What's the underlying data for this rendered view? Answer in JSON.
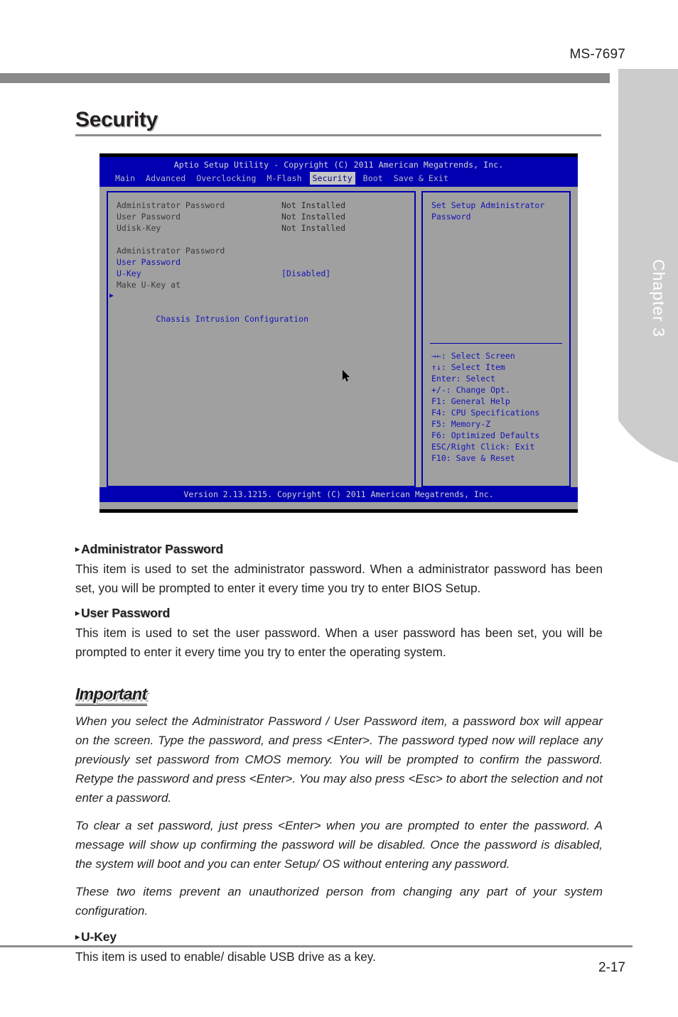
{
  "header": {
    "model_code": "MS-7697",
    "chapter_label": "Chapter 3"
  },
  "page_title": "Security",
  "bios": {
    "title": "Aptio Setup Utility - Copyright (C) 2011 American Megatrends, Inc.",
    "menu": [
      {
        "label": "Main",
        "active": false
      },
      {
        "label": "Advanced",
        "active": false
      },
      {
        "label": "Overclocking",
        "active": false
      },
      {
        "label": "M-Flash",
        "active": false
      },
      {
        "label": "Security",
        "active": true
      },
      {
        "label": "Boot",
        "active": false
      },
      {
        "label": "Save & Exit",
        "active": false
      }
    ],
    "status_rows": [
      {
        "label": "Administrator Password",
        "value": "Not Installed"
      },
      {
        "label": "User Password",
        "value": "Not Installed"
      },
      {
        "label": "Udisk-Key",
        "value": "Not Installed"
      }
    ],
    "setting_rows": [
      {
        "label": "Administrator Password",
        "value": "",
        "arrow": false
      },
      {
        "label": "User Password",
        "value": "",
        "arrow": false
      },
      {
        "label": "U-Key",
        "value": "[Disabled]",
        "arrow": false
      },
      {
        "label": "Make U-Key at",
        "value": "",
        "arrow": false
      },
      {
        "label": "Chassis Intrusion Configuration",
        "value": "",
        "arrow": true
      }
    ],
    "help_text": "Set Setup Administrator\nPassword",
    "help_keys": [
      "→←: Select Screen",
      "↑↓: Select Item",
      "Enter: Select",
      "+/-: Change Opt.",
      "F1: General Help",
      "F4: CPU Specifications",
      "F5: Memory-Z",
      "F6: Optimized Defaults",
      "ESC/Right Click: Exit",
      "F10: Save & Reset"
    ],
    "footer": "Version 2.13.1215. Copyright (C) 2011 American Megatrends, Inc."
  },
  "sections": {
    "admin_heading": "Administrator Password",
    "admin_body": "This item is used to set the administrator password. When a administrator password has been set, you will be prompted to enter it every time you try to enter BIOS Setup.",
    "user_heading": "User Password",
    "user_body": "This item is used to set the user password. When a user password has been set, you will be prompted to enter it every time you try to enter the operating system.",
    "important_title": "Important",
    "important_p1": "When you select the Administrator Password / User Password item, a password box will appear on the screen. Type the password, and press <Enter>. The password typed now will replace any previously set password from CMOS memory. You will be prompted to confirm the password. Retype the password and press <Enter>. You may also press <Esc> to abort the selection and not enter a password.",
    "important_p2": "To clear a set password, just press <Enter> when you are prompted to enter the password. A message will show up confirming the password will be disabled. Once the password is disabled, the system will boot and you can enter Setup/ OS without entering any password.",
    "important_p3": "These two items prevent an unauthorized person from changing any part of your system configuration.",
    "ukey_heading": "U-Key",
    "ukey_body": "This item is used to enable/ disable USB drive as a key.",
    "bullet": "▸"
  },
  "footer": {
    "page_number": "2-17"
  },
  "colors": {
    "bios_blue": "#0000b0",
    "bios_gray": "#a0a0a0",
    "accent_gray": "#898989"
  }
}
